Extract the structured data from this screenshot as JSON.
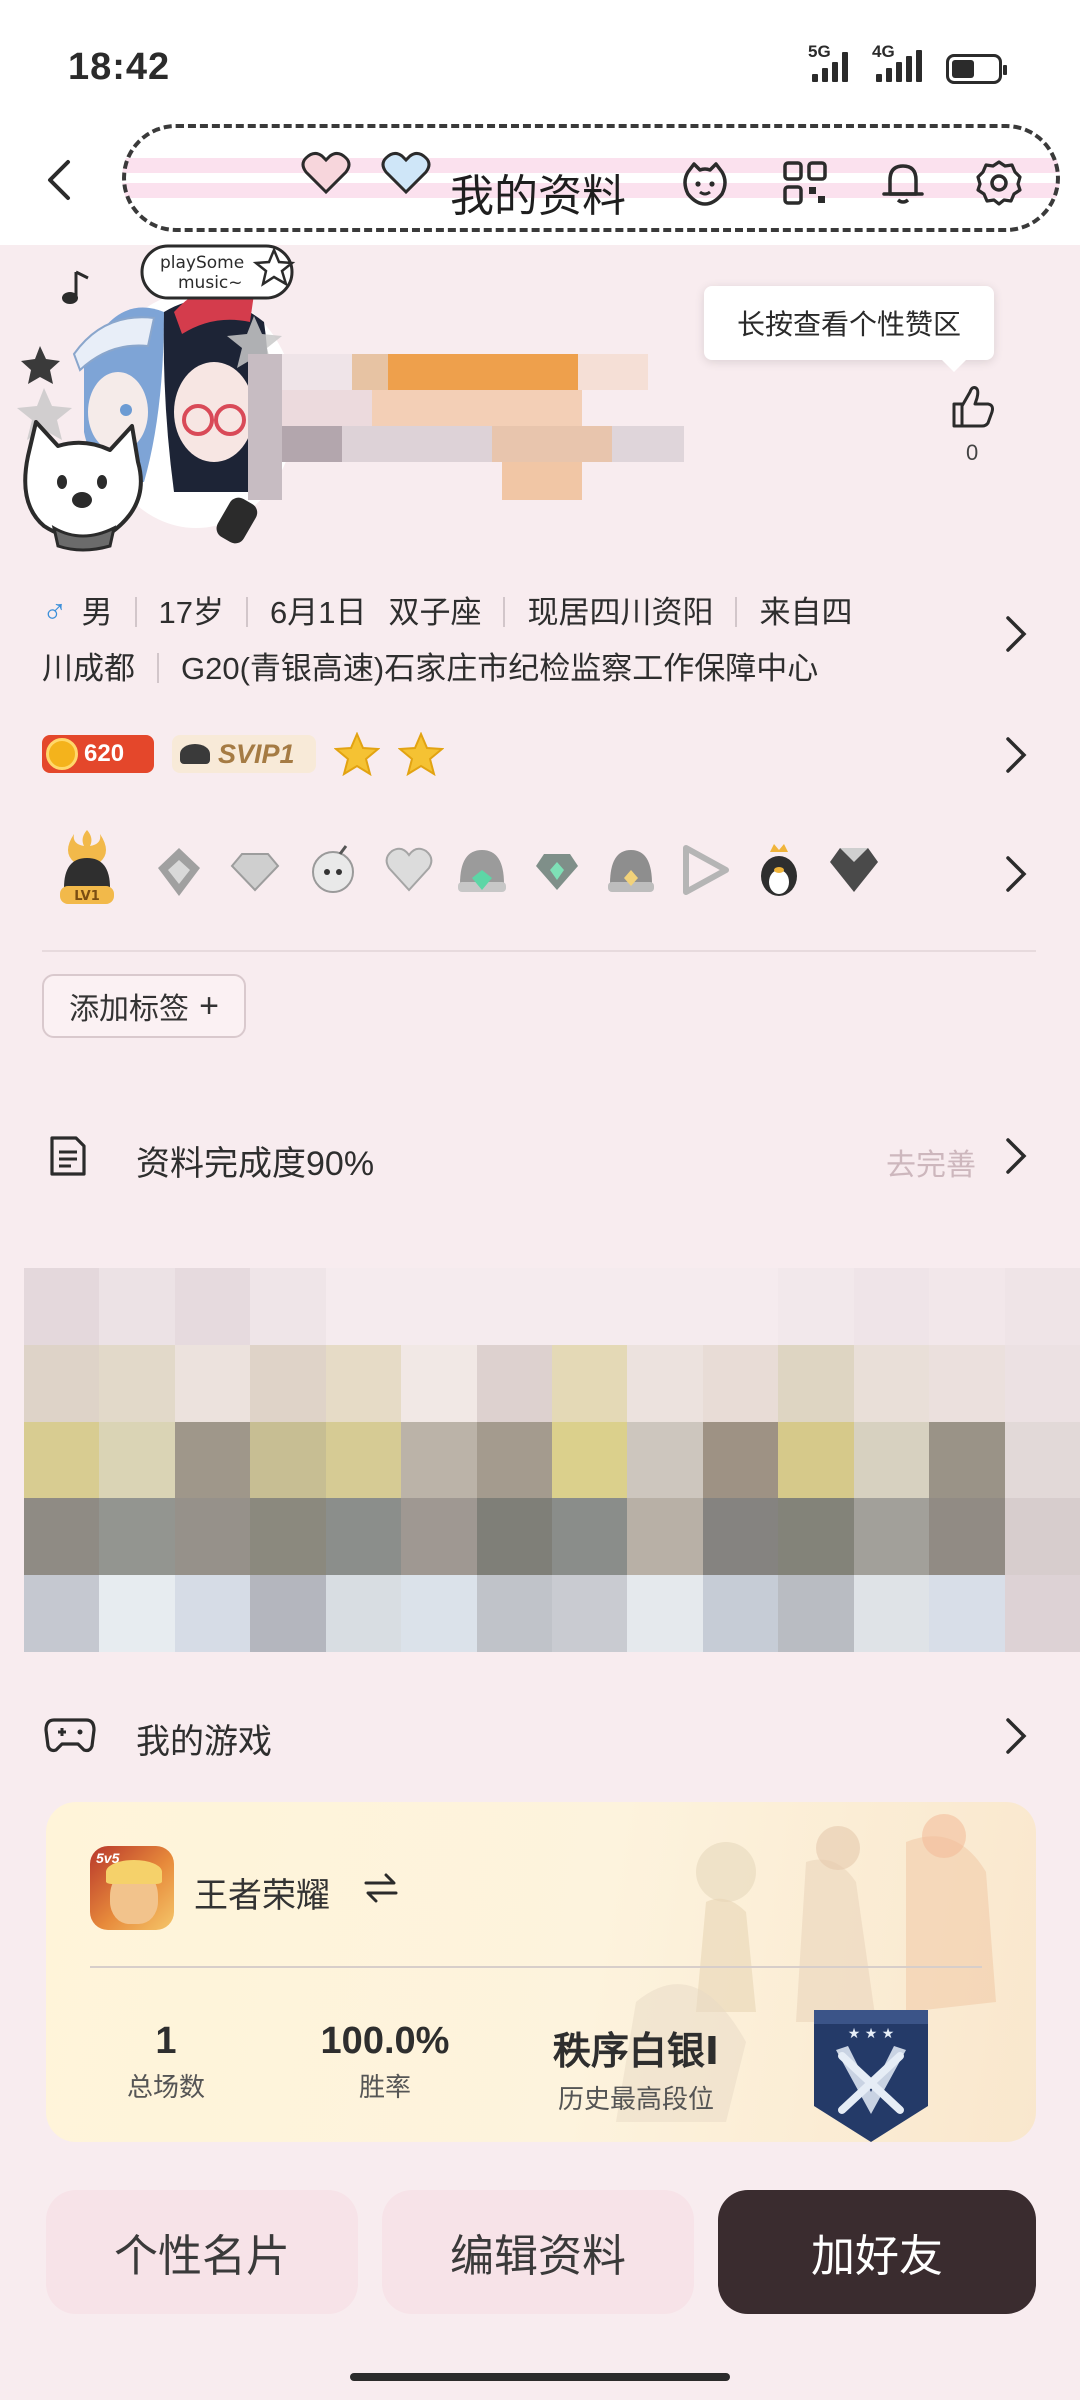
{
  "status_bar": {
    "time": "18:42",
    "signal1_label": "5G",
    "signal2_label": "4G"
  },
  "nav": {
    "title": "我的资料"
  },
  "profile": {
    "tooltip": "长按查看个性赞区",
    "like_count": "0",
    "gender_symbol": "♂",
    "info_line1": [
      "男",
      "17岁",
      "6月1日",
      "双子座",
      "现居四川资阳",
      "来自四"
    ],
    "info_line2": [
      "川成都",
      "G20(青银高速)石家庄市纪检监察工作保障中心"
    ],
    "coin_value": "620",
    "vip_label": "SVIP1",
    "medal_level": "LV1",
    "add_tag_label": "添加标签"
  },
  "completion": {
    "label": "资料完成度90%",
    "goto": "去完善"
  },
  "games": {
    "section_title": "我的游戏",
    "game_name": "王者荣耀",
    "icon_text": "5v5",
    "stats": [
      {
        "value": "1",
        "label": "总场数"
      },
      {
        "value": "100.0%",
        "label": "胜率"
      },
      {
        "value": "秩序白银Ⅰ",
        "label": "历史最高段位"
      }
    ]
  },
  "actions": {
    "card": "个性名片",
    "edit": "编辑资料",
    "add_friend": "加好友"
  },
  "colors": {
    "accent_dark": "#3a2c2f",
    "background": "#f8ecef",
    "male_blue": "#3b8fd9",
    "coin_red": "#e4472b"
  },
  "icons": [
    "back-icon",
    "pink-heart-icon",
    "blue-heart-icon",
    "pet-icon",
    "qr-code-icon",
    "bell-icon",
    "settings-icon",
    "thumbs-up-icon",
    "chevron-right-icon",
    "document-icon",
    "gamepad-icon",
    "switch-icon"
  ]
}
